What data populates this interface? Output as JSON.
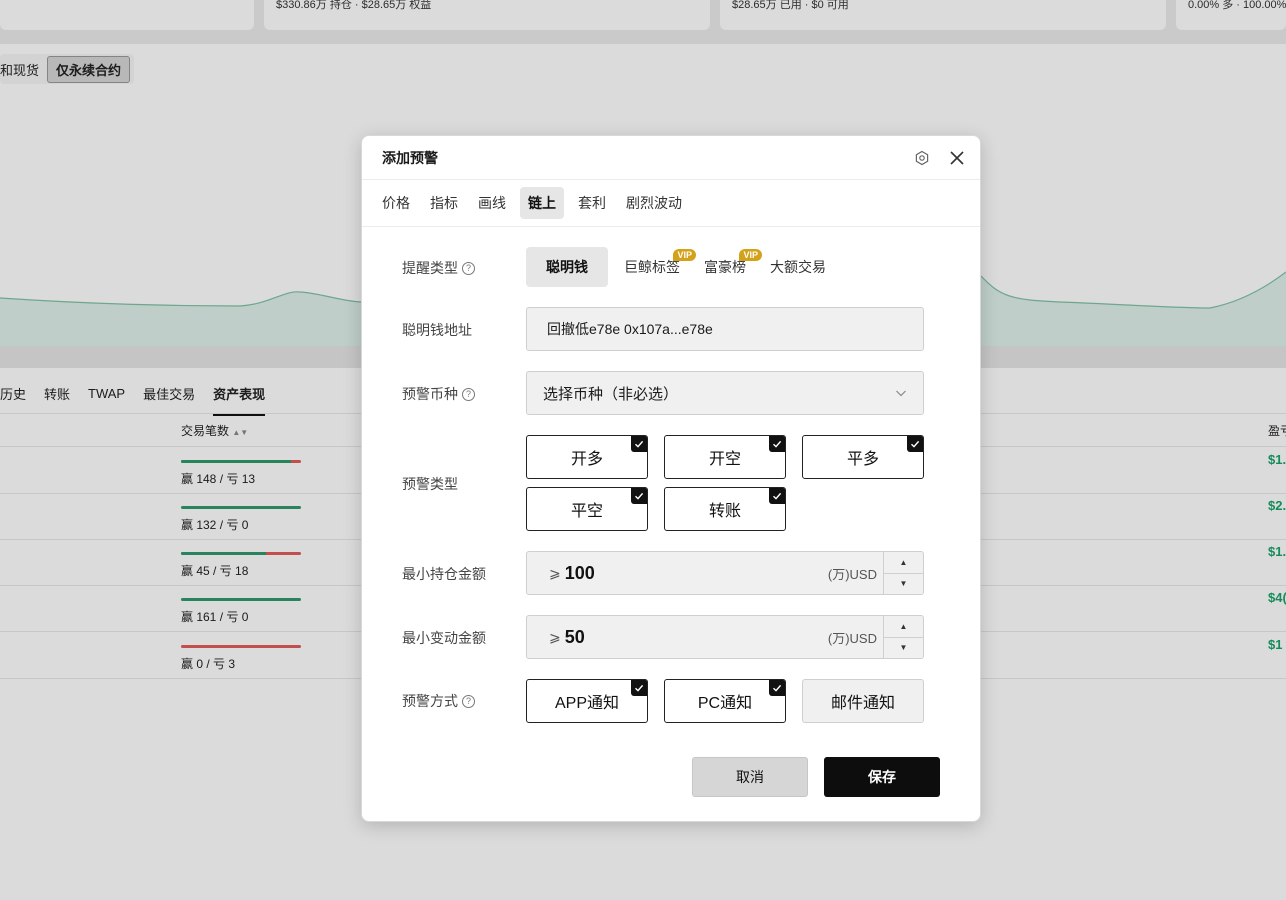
{
  "background": {
    "stat_cards": [
      {
        "text": "$330.86万 持仓 · $28.65万 权益"
      },
      {
        "text": "$28.65万 已用 · $0 可用"
      },
      {
        "text": "0.00% 多 · 100.00%"
      }
    ],
    "filters": [
      "和现货",
      "仅永续合约"
    ],
    "tabs": [
      "历史",
      "转账",
      "TWAP",
      "最佳交易",
      "资产表现"
    ],
    "columns": {
      "trades": "交易笔数",
      "pnl": "盈亏"
    },
    "rows": [
      {
        "wl": "赢 148 / 亏 13",
        "win_ratio": 0.92,
        "pnl": "$1."
      },
      {
        "wl": "赢 132 / 亏 0",
        "win_ratio": 1.0,
        "pnl": "$2."
      },
      {
        "wl": "赢 45 / 亏 18",
        "win_ratio": 0.71,
        "pnl": "$1."
      },
      {
        "wl": "赢 161 / 亏 0",
        "win_ratio": 1.0,
        "pnl": "$4("
      },
      {
        "wl": "赢 0 / 亏 3",
        "win_ratio": 0.0,
        "pnl": "$1"
      }
    ]
  },
  "modal": {
    "title": "添加预警",
    "tabs": [
      "价格",
      "指标",
      "画线",
      "链上",
      "套利",
      "剧烈波动"
    ],
    "alert_type": {
      "label": "提醒类型",
      "options": [
        {
          "label": "聪明钱",
          "vip": ""
        },
        {
          "label": "巨鲸标签",
          "vip": "VIP"
        },
        {
          "label": "富豪榜",
          "vip": "VIP"
        },
        {
          "label": "大额交易",
          "vip": ""
        }
      ]
    },
    "address": {
      "label": "聪明钱地址",
      "value": "回撤低e78e 0x107a...e78e"
    },
    "coin": {
      "label": "预警币种",
      "placeholder": "选择币种（非必选）"
    },
    "warn_type": {
      "label": "预警类型",
      "options": [
        "开多",
        "开空",
        "平多",
        "平空",
        "转账"
      ]
    },
    "min_position": {
      "label": "最小持仓金额",
      "prefix": "⩾",
      "value": "100",
      "unit": "(万)USD"
    },
    "min_change": {
      "label": "最小变动金额",
      "prefix": "⩾",
      "value": "50",
      "unit": "(万)USD"
    },
    "notify": {
      "label": "预警方式",
      "options": [
        {
          "label": "APP通知",
          "checked": true
        },
        {
          "label": "PC通知",
          "checked": true
        },
        {
          "label": "邮件通知",
          "checked": false
        }
      ]
    },
    "cancel": "取消",
    "save": "保存"
  }
}
